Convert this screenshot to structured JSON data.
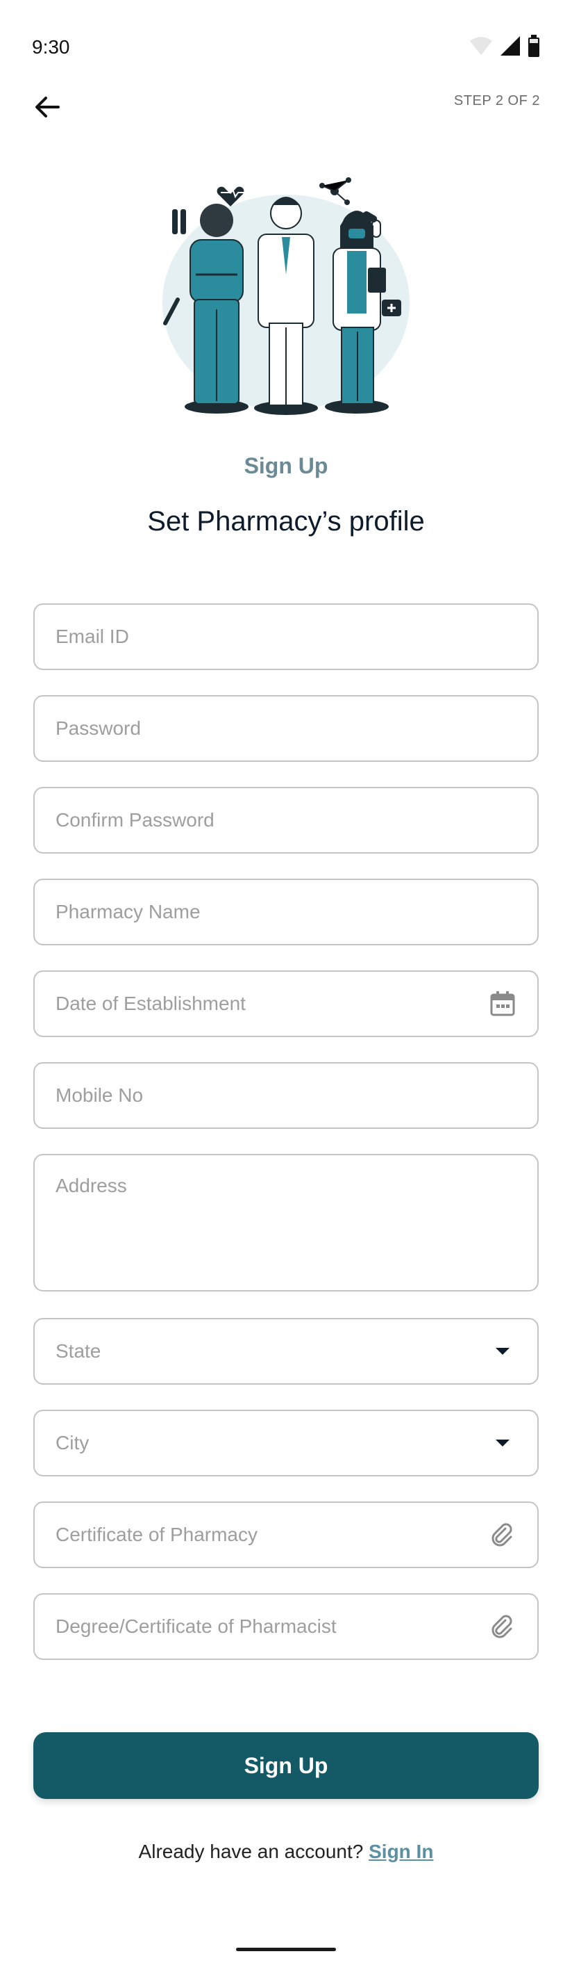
{
  "status_bar": {
    "time": "9:30"
  },
  "header": {
    "back_icon": "arrow-left-icon",
    "step": "STEP 2 OF 2"
  },
  "hero": {
    "eyebrow": "Sign Up",
    "title": "Set Pharmacy’s profile"
  },
  "form": {
    "email_placeholder": "Email ID",
    "password_placeholder": "Password",
    "confirm_password_placeholder": "Confirm Password",
    "pharmacy_name_placeholder": "Pharmacy Name",
    "date_placeholder": "Date of Establishment",
    "mobile_placeholder": "Mobile No",
    "address_placeholder": "Address",
    "state_placeholder": "State",
    "city_placeholder": "City",
    "certificate_placeholder": "Certificate of Pharmacy",
    "degree_placeholder": "Degree/Certificate of Pharmacist"
  },
  "actions": {
    "sign_up_label": "Sign Up"
  },
  "footer": {
    "prompt": "Already have an account?",
    "sign_in_label": "Sign In"
  },
  "colors": {
    "primary": "#145966",
    "eyebrow": "#6b8a96",
    "teal": "#2a8c9c",
    "link": "#5b8fa1"
  },
  "icons": [
    "wifi-icon",
    "signal-icon",
    "battery-icon",
    "calendar-icon",
    "dropdown-icon",
    "attachment-icon"
  ]
}
